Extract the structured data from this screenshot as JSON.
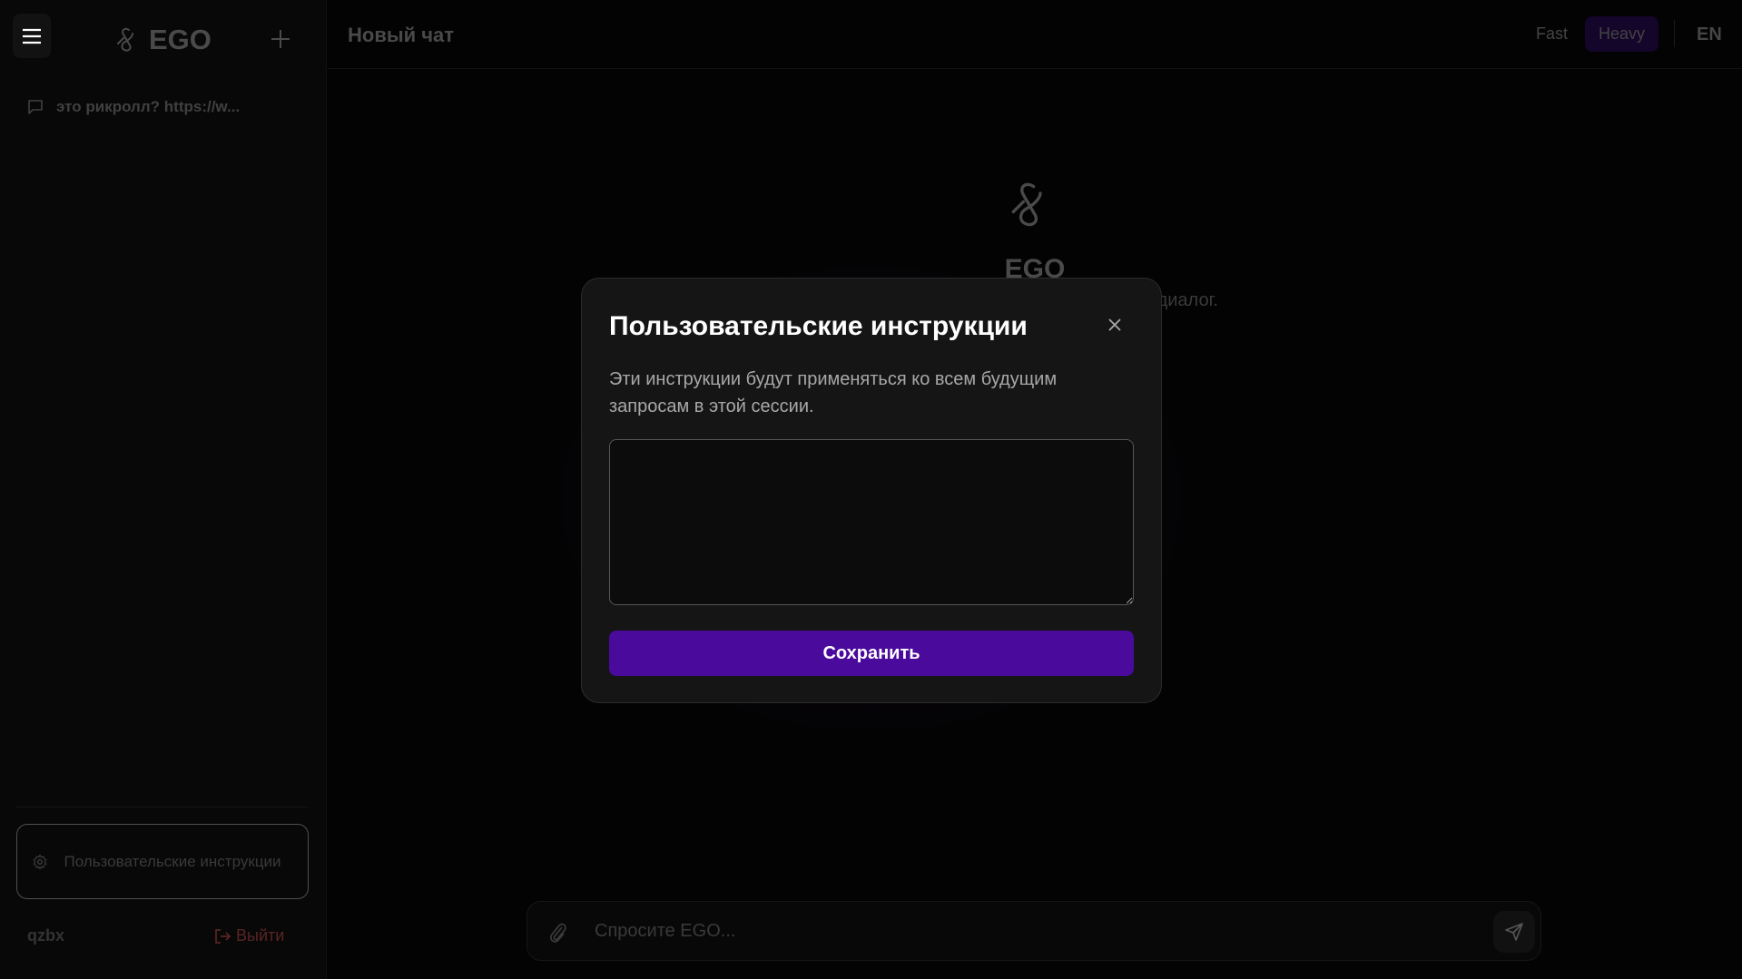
{
  "sidebar": {
    "brand": "EGO",
    "chats": [
      {
        "title": "это рикролл? https://w..."
      }
    ],
    "instructions_button": "Пользовательские инструкции",
    "username": "qzbx",
    "logout_label": "Выйти"
  },
  "header": {
    "title": "Новый чат",
    "modes": [
      "Fast",
      "Heavy"
    ],
    "active_mode": "Heavy",
    "language": "EN"
  },
  "main": {
    "brand": "EGO",
    "subtitle_visible": "диалог."
  },
  "composer": {
    "placeholder": "Спросите EGO...",
    "value": ""
  },
  "modal": {
    "title": "Пользовательские инструкции",
    "description": "Эти инструкции будут применяться ко всем будущим запросам в этой сессии.",
    "textarea_value": "",
    "save_label": "Сохранить"
  },
  "colors": {
    "accent": "#4a0a9c",
    "active_mode_bg": "#14052a",
    "logout": "#5a2424"
  }
}
